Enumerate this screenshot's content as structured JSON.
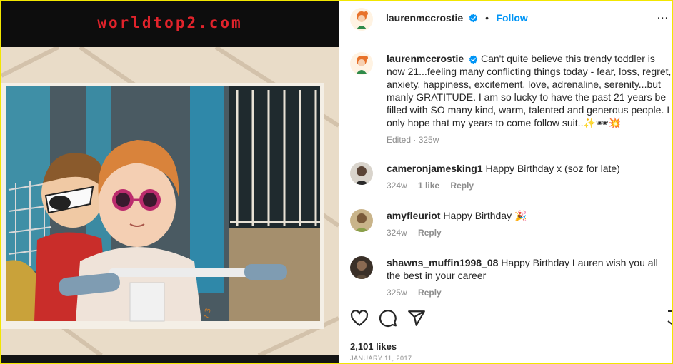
{
  "watermark": "worldtop2.com",
  "photo": {
    "alt_subject": "two toddlers in sunglasses"
  },
  "post": {
    "username": "laurenmccrostie",
    "follow_label": "Follow",
    "separator": "•",
    "more_label": "...",
    "caption": "Can't quite believe this trendy toddler is now 21...feeling many conflicting things today - fear, loss, regret, anxiety, happiness, excitement, love, adrenaline, serenity...but manly GRATITUDE. I am so lucky to have the past 21 years be filled with SO many kind, warm, talented and generous people. I only hope that my years to come follow suit..✨🕶💥",
    "caption_meta": "Edited · 325w",
    "likes": "2,101 likes",
    "date": "JANUARY 11, 2017"
  },
  "comments": [
    {
      "username": "cameronjamesking1",
      "text": "Happy Birthday x (soz for late)",
      "time": "324w",
      "likes": "1 like",
      "reply": "Reply"
    },
    {
      "username": "amyfleuriot",
      "text": "Happy Birthday 🎉",
      "time": "324w",
      "likes": "",
      "reply": "Reply"
    },
    {
      "username": "shawns_muffin1998_08",
      "text": "Happy Birthday Lauren wish you all the best in your career",
      "time": "325w",
      "likes": "",
      "reply": "Reply"
    }
  ],
  "icons": {
    "verified": "verified-badge-icon",
    "like": "heart-icon",
    "comment": "comment-bubble-icon",
    "share": "paper-plane-icon",
    "save": "bookmark-icon"
  },
  "colors": {
    "accent": "#0095f6",
    "watermark": "#e0232b",
    "border": "#f2e600",
    "muted": "#8e8e8e"
  }
}
